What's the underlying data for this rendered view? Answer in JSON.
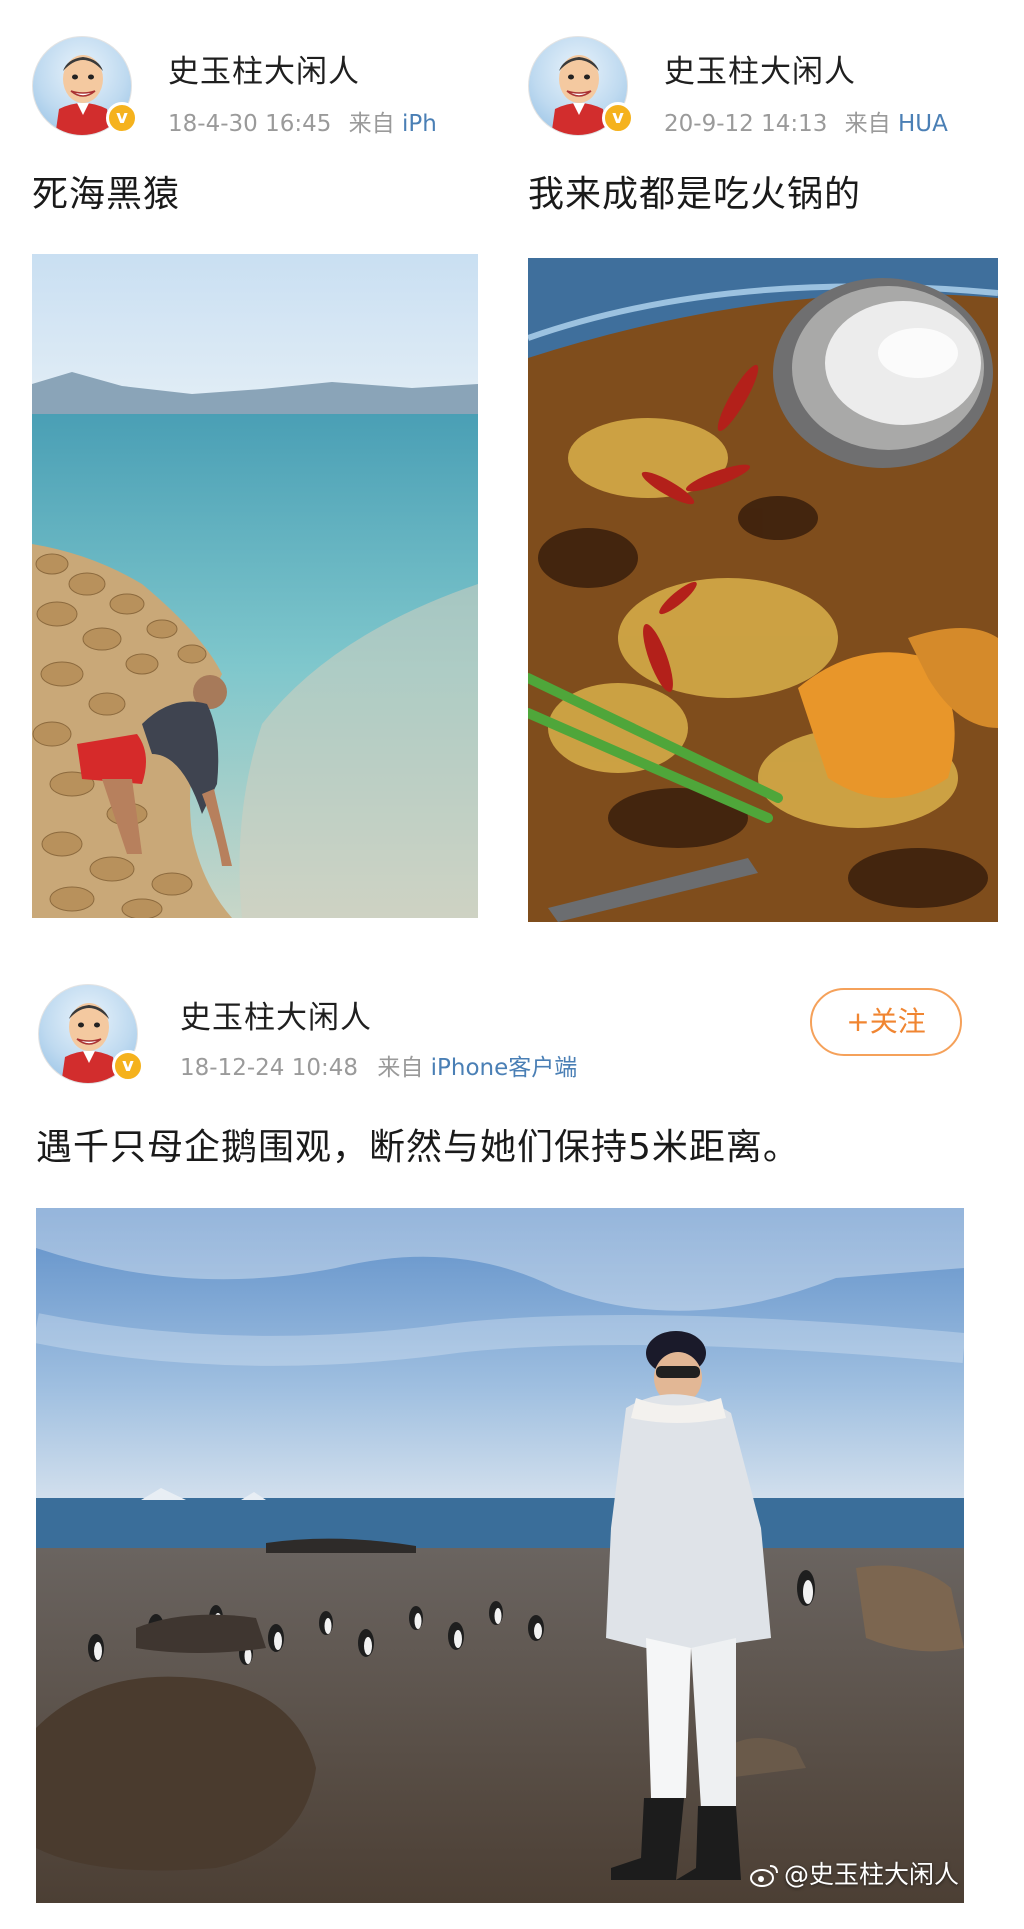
{
  "posts": [
    {
      "username": "史玉柱大闲人",
      "time": "18-4-30 16:45",
      "source_prefix": "来自",
      "source": "iPh",
      "text": "死海黑猿",
      "verified_badge": "v"
    },
    {
      "username": "史玉柱大闲人",
      "time": "20-9-12 14:13",
      "source_prefix": "来自",
      "source": "HUA",
      "text": "我来成都是吃火锅的",
      "verified_badge": "v"
    },
    {
      "username": "史玉柱大闲人",
      "time": "18-12-24 10:48",
      "source_prefix": "来自",
      "source": "iPhone客户端",
      "text": "遇千只母企鹅围观，断然与她们保持5米距离。",
      "verified_badge": "v",
      "follow_label": "+关注",
      "watermark": "@史玉柱大闲人"
    }
  ],
  "colors": {
    "accent_orange": "#f08531",
    "source_blue": "#4a7fb5",
    "meta_gray": "#9a9a9a",
    "verified_gold": "#f5b21d"
  },
  "icons": [
    "verified-badge-icon",
    "weibo-logo-icon"
  ]
}
